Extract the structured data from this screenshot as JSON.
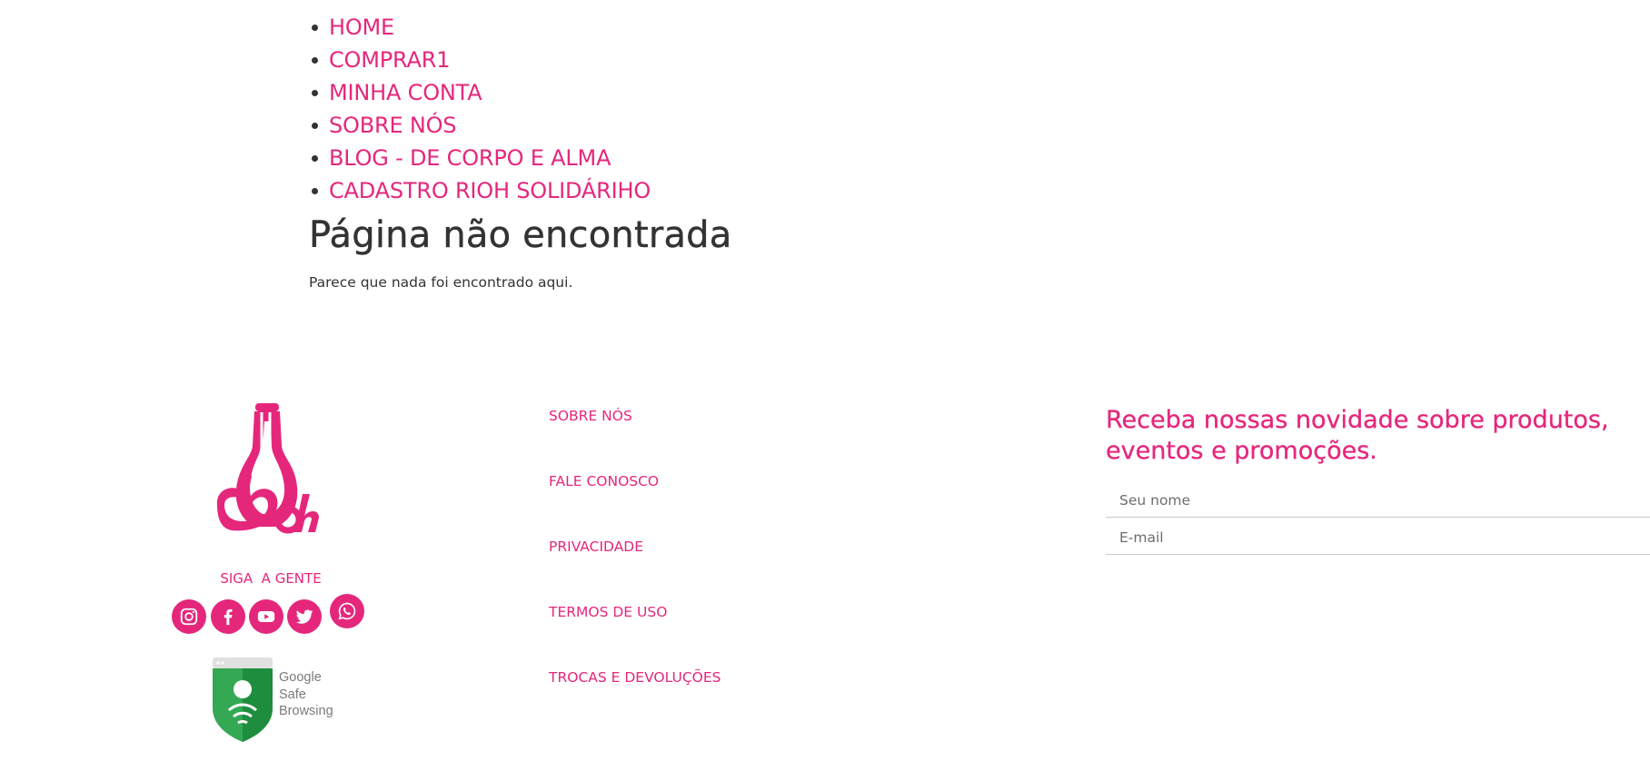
{
  "nav": {
    "items": [
      {
        "label": "HOME"
      },
      {
        "label": "COMPRAR1"
      },
      {
        "label": "MINHA CONTA"
      },
      {
        "label": "SOBRE NÓS"
      },
      {
        "label": "BLOG - DE CORPO E ALMA"
      },
      {
        "label": "CADASTRO RIOH SOLIDÁRIHO"
      }
    ]
  },
  "main": {
    "title": "Página não encontrada",
    "message": "Parece que nada foi encontrado aqui."
  },
  "footer": {
    "follow_label": "SIGA  A GENTE",
    "socials": [
      {
        "icon": "instagram-icon"
      },
      {
        "icon": "facebook-icon"
      },
      {
        "icon": "youtube-icon"
      },
      {
        "icon": "twitter-icon"
      },
      {
        "icon": "whatsapp-icon"
      }
    ],
    "safe_browsing": {
      "line1": "Google",
      "line2": "Safe",
      "line3": "Browsing"
    },
    "links": [
      {
        "label": "SOBRE NÓS"
      },
      {
        "label": "FALE CONOSCO"
      },
      {
        "label": "PRIVACIDADE"
      },
      {
        "label": "TERMOS DE USO"
      },
      {
        "label": "TROCAS E DEVOLUÇÕES"
      }
    ],
    "newsletter": {
      "title": "Receba nossas novidade sobre produtos, eventos e promoções.",
      "name_placeholder": "Seu nome",
      "email_placeholder": "E-mail"
    }
  },
  "colors": {
    "accent": "#e5277c",
    "text": "#333333",
    "google_green": "#1e8e3e"
  }
}
